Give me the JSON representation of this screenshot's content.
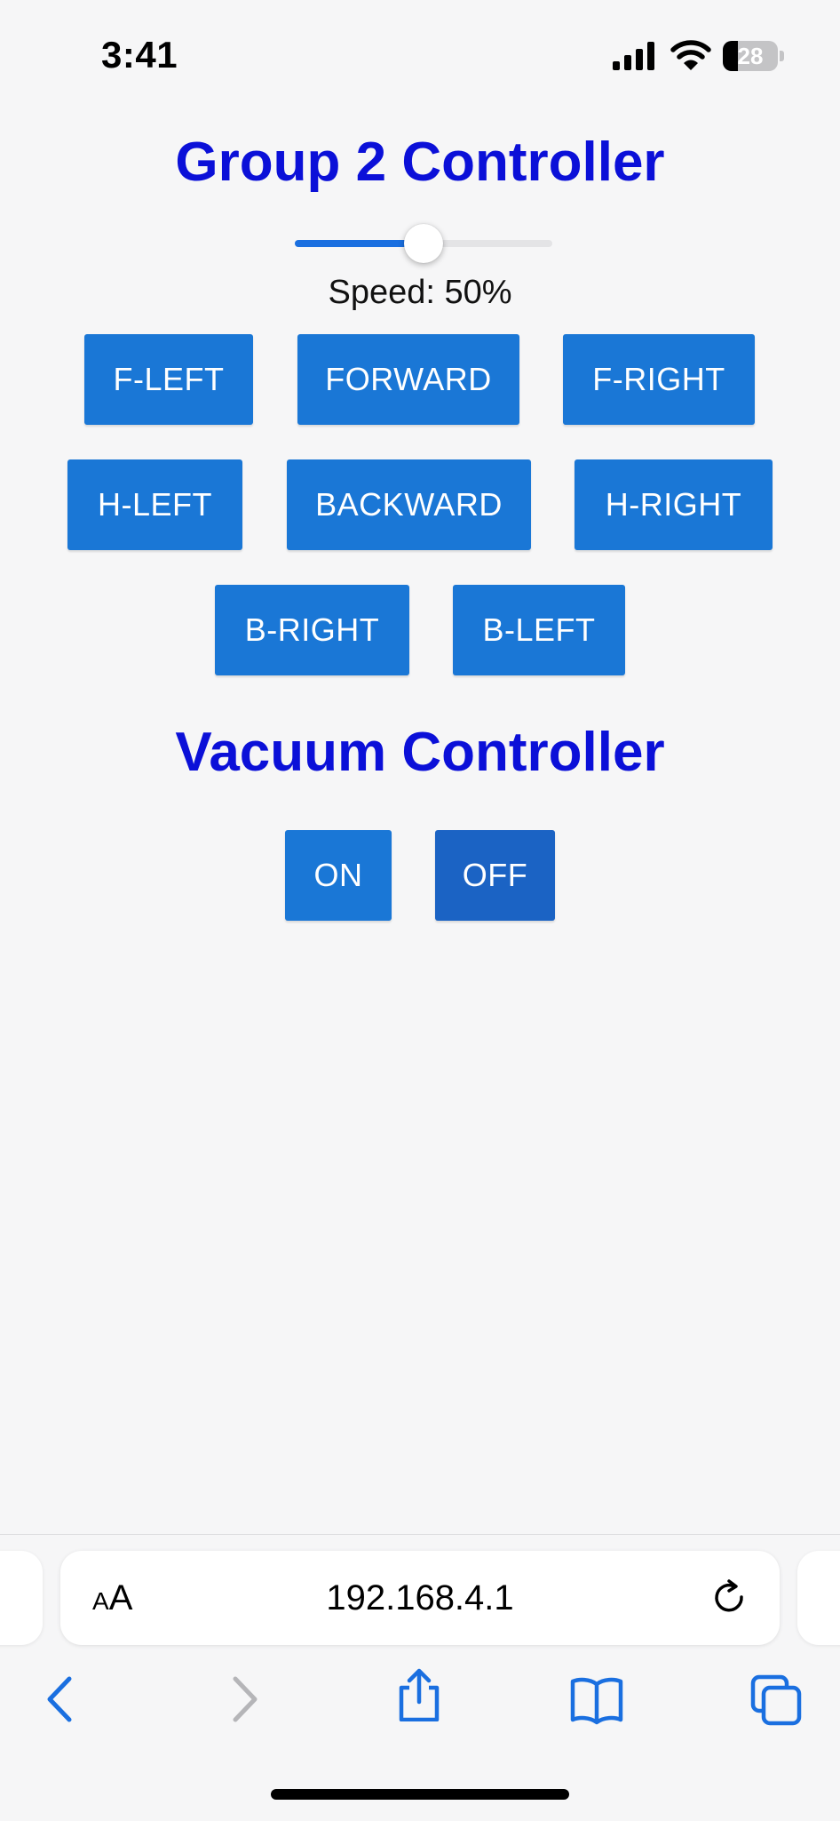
{
  "status_bar": {
    "time": "3:41",
    "battery_level": "28",
    "battery_fraction": 0.28,
    "icons": [
      "signal-icon",
      "wifi-icon",
      "battery-icon"
    ]
  },
  "controller": {
    "title": "Group 2 Controller",
    "speed": {
      "label": "Speed: 50%",
      "value_fraction": 0.5
    },
    "buttons": {
      "f_left": "F-LEFT",
      "forward": "FORWARD",
      "f_right": "F-RIGHT",
      "h_left": "H-LEFT",
      "backward": "BACKWARD",
      "h_right": "H-RIGHT",
      "b_right": "B-RIGHT",
      "b_left": "B-LEFT"
    }
  },
  "vacuum": {
    "title": "Vacuum Controller",
    "buttons": {
      "on": "ON",
      "off": "OFF"
    }
  },
  "browser": {
    "aa_small": "A",
    "aa_large": "A",
    "url": "192.168.4.1",
    "icons": [
      "text-size-icon",
      "reload-icon",
      "back-icon",
      "forward-icon",
      "share-icon",
      "bookmarks-icon",
      "tabs-icon"
    ]
  },
  "colors": {
    "title": "#0b10d8",
    "button": "#1a77d6",
    "button_active": "#1b63c4",
    "accent": "#1a6fe0",
    "background": "#f6f6f7"
  }
}
